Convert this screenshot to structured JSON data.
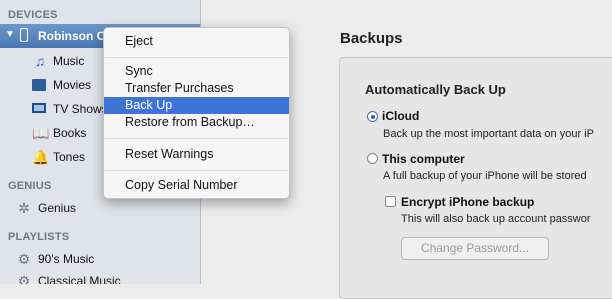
{
  "sidebar": {
    "devices_header": "DEVICES",
    "device_name": "Robinson C",
    "library_items": [
      {
        "label": "Music",
        "icon": "music-note-icon"
      },
      {
        "label": "Movies",
        "icon": "film-icon"
      },
      {
        "label": "TV Shows",
        "icon": "tv-icon"
      },
      {
        "label": "Books",
        "icon": "book-icon"
      },
      {
        "label": "Tones",
        "icon": "bell-icon"
      }
    ],
    "genius_header": "GENIUS",
    "genius_item": "Genius",
    "playlists_header": "PLAYLISTS",
    "playlists": [
      "90's Music",
      "Classical Music"
    ]
  },
  "context_menu": {
    "items": [
      "Eject",
      "Sync",
      "Transfer Purchases",
      "Back Up",
      "Restore from Backup…",
      "Reset Warnings",
      "Copy Serial Number"
    ],
    "selected": "Back Up"
  },
  "backups": {
    "title": "Backups",
    "subtitle": "Automatically Back Up",
    "icloud_label": "iCloud",
    "icloud_desc": "Back up the most important data on your iP",
    "computer_label": "This computer",
    "computer_desc": "A full backup of your iPhone will be stored",
    "encrypt_label": "Encrypt iPhone backup",
    "encrypt_desc": "This will also back up account passwor",
    "change_password": "Change Password..."
  },
  "colors": {
    "selection": "#3e74d6",
    "sidebar_bg": "#dfe4ea",
    "device_row": "#4a77b3"
  }
}
